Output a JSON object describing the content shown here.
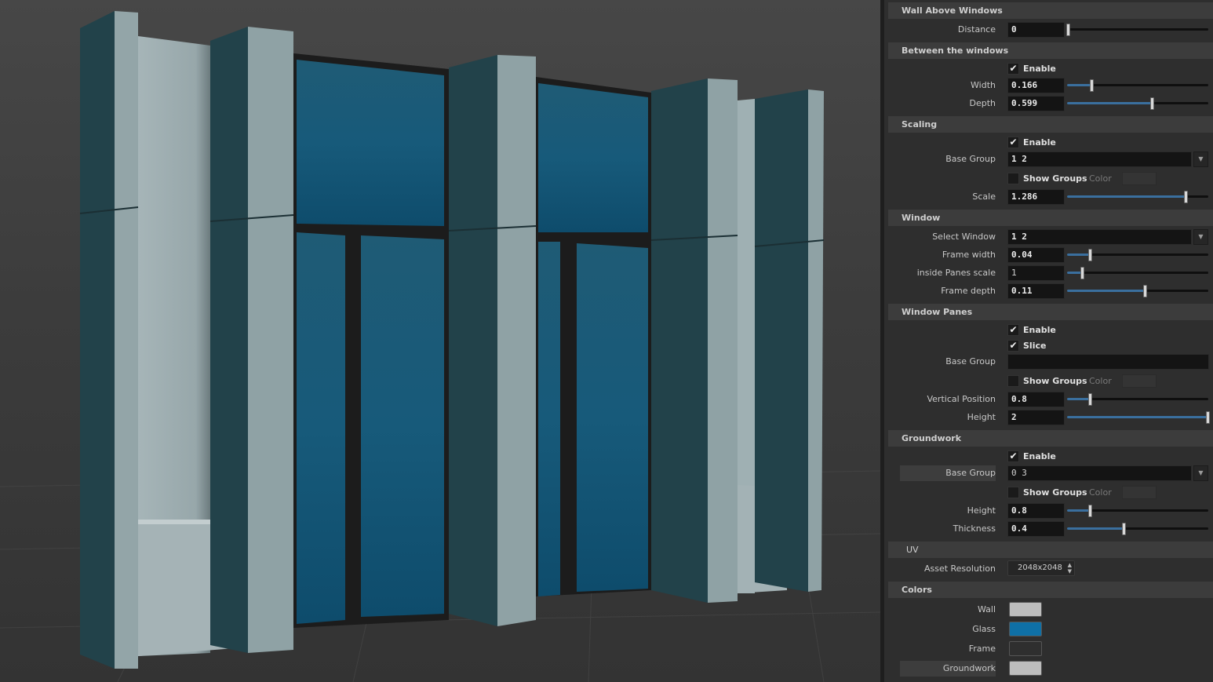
{
  "viewport": {
    "colors": {
      "floor_near": "#3c3c3c",
      "floor_far": "#454545",
      "grid_line": "#4c4c4c",
      "wall_light": "#8d9ea2",
      "wall_face": "#a7b6b9",
      "pillar_side": "#23434a",
      "pillar_front": "#8fa2a5",
      "glass_top": "#1e5f7a",
      "glass_bottom": "#0e4f70",
      "frame": "#1a1a1a"
    }
  },
  "panel": {
    "wall_above_windows": {
      "title": "Wall Above Windows",
      "distance_label": "Distance",
      "distance_value": "0",
      "distance_fraction": 0.0
    },
    "between_windows": {
      "title": "Between the windows",
      "enable_label": "Enable",
      "enable_checked": true,
      "width_label": "Width",
      "width_value": "0.166",
      "width_fraction": 0.17,
      "depth_label": "Depth",
      "depth_value": "0.599",
      "depth_fraction": 0.6
    },
    "scaling": {
      "title": "Scaling",
      "enable_label": "Enable",
      "enable_checked": true,
      "base_group_label": "Base Group",
      "base_group_value": "1 2",
      "show_groups_label": "Show Groups",
      "show_groups_checked": false,
      "color_label": "Color",
      "scale_label": "Scale",
      "scale_value": "1.286",
      "scale_fraction": 0.84
    },
    "window": {
      "title": "Window",
      "select_window_label": "Select Window",
      "select_window_value": "1 2",
      "frame_width_label": "Frame width",
      "frame_width_value": "0.04",
      "frame_width_fraction": 0.16,
      "inside_panes_label": "inside Panes scale",
      "inside_panes_value": "1",
      "inside_panes_fraction": 0.1,
      "frame_depth_label": "Frame depth",
      "frame_depth_value": "0.11",
      "frame_depth_fraction": 0.55
    },
    "window_panes": {
      "title": "Window Panes",
      "enable_label": "Enable",
      "enable_checked": true,
      "slice_label": "Slice",
      "slice_checked": true,
      "base_group_label": "Base Group",
      "base_group_value": "",
      "show_groups_label": "Show Groups",
      "show_groups_checked": false,
      "color_label": "Color",
      "vertical_position_label": "Vertical Position",
      "vertical_position_value": "0.8",
      "vertical_position_fraction": 0.16,
      "height_label": "Height",
      "height_value": "2",
      "height_fraction": 1.0
    },
    "groundwork": {
      "title": "Groundwork",
      "enable_label": "Enable",
      "enable_checked": true,
      "base_group_label": "Base Group",
      "base_group_value": "0 3",
      "show_groups_label": "Show Groups",
      "show_groups_checked": false,
      "color_label": "Color",
      "height_label": "Height",
      "height_value": "0.8",
      "height_fraction": 0.16,
      "thickness_label": "Thickness",
      "thickness_value": "0.4",
      "thickness_fraction": 0.4
    },
    "uv": {
      "title": "UV",
      "asset_resolution_label": "Asset Resolution",
      "asset_resolution_value": "2048x2048",
      "stepper_up": "▲",
      "stepper_down": "▼"
    },
    "colors": {
      "title": "Colors",
      "wall_label": "Wall",
      "wall_color": "#bdbdbd",
      "glass_label": "Glass",
      "glass_color": "#0f70a6",
      "frame_label": "Frame",
      "frame_color": "#2f2f2f",
      "groundwork_label": "Groundwork",
      "groundwork_color": "#bdbdbd"
    },
    "icons": {
      "check": "✔",
      "dropdown": "▼"
    }
  }
}
